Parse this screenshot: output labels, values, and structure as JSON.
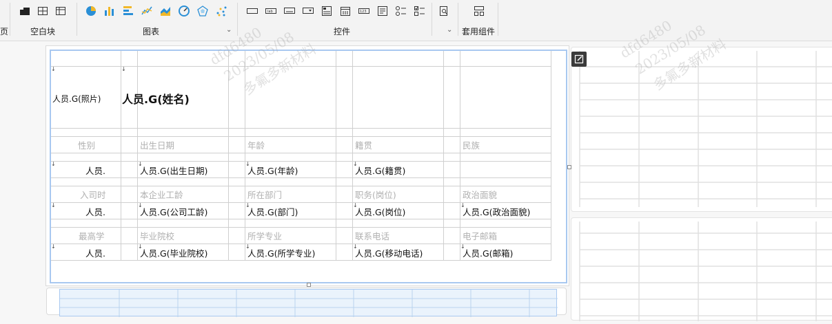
{
  "ribbon": {
    "group_blank_label": "空白块",
    "group_chart_label": "图表",
    "group_widget_label": "控件",
    "group_common_label": "套用组件",
    "group_left_partial": "页"
  },
  "report": {
    "photo_label": "人员.G(照片)",
    "name_value": "人员.G(姓名)",
    "row1_labels": [
      "性别",
      "出生日期",
      "年龄",
      "籍贯",
      "民族"
    ],
    "row1_values": [
      "人员.",
      "人员.G(出生日期)",
      "人员.G(年龄)",
      "人员.G(籍贯)",
      ""
    ],
    "row2_labels": [
      "入司时",
      "本企业工龄",
      "所在部门",
      "职务(岗位)",
      "政治面貌"
    ],
    "row2_values": [
      "人员.",
      "人员.G(公司工龄)",
      "人员.G(部门)",
      "人员.G(岗位)",
      "人员.G(政治面貌)"
    ],
    "row3_labels": [
      "最高学",
      "毕业院校",
      "所学专业",
      "联系电话",
      "电子邮箱"
    ],
    "row3_values": [
      "人员.",
      "人员.G(毕业院校)",
      "人员.G(所学专业)",
      "人员.G(移动电话)",
      "人员.G(邮箱)"
    ]
  },
  "watermark": {
    "line1": "dfd6480",
    "line2": "2023/05/08",
    "line3": "多氟多新材料"
  },
  "colors": {
    "selection_border": "#a8c8f0",
    "label_text": "#b0b0b0",
    "value_text": "#111111"
  }
}
